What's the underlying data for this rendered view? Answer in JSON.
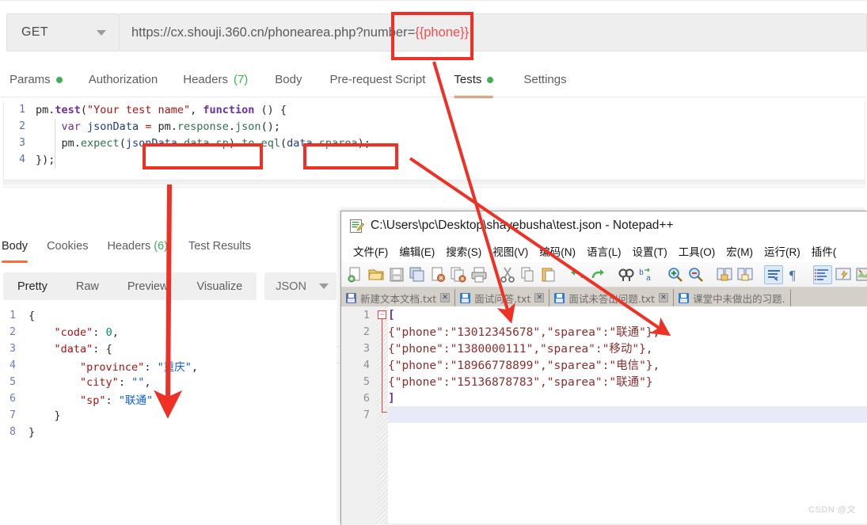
{
  "postman": {
    "request": {
      "method": "GET",
      "url_static": "https://cx.shouji.360.cn/phonearea.php?number=",
      "url_variable": "{{phone}}"
    },
    "request_tabs": [
      {
        "label": "Params",
        "badge": "dot",
        "active": false
      },
      {
        "label": "Authorization",
        "badge": "",
        "active": false
      },
      {
        "label": "Headers",
        "badge": "(7)",
        "active": false
      },
      {
        "label": "Body",
        "badge": "",
        "active": false
      },
      {
        "label": "Pre-request Script",
        "badge": "",
        "active": false
      },
      {
        "label": "Tests",
        "badge": "dot",
        "active": true
      },
      {
        "label": "Settings",
        "badge": "",
        "active": false
      }
    ],
    "tests_code": {
      "lines": [
        {
          "n": "1",
          "text": "pm.test(\"Your test name\", function () {"
        },
        {
          "n": "2",
          "text": "    var jsonData = pm.response.json();"
        },
        {
          "n": "3",
          "text": "    pm.expect(jsonData.data.sp).to.eql(data.sparea);"
        },
        {
          "n": "4",
          "text": "});"
        }
      ]
    },
    "response_tabs": [
      {
        "label": "Body",
        "badge": "",
        "active": true
      },
      {
        "label": "Cookies",
        "badge": "",
        "active": false
      },
      {
        "label": "Headers",
        "badge": "(6)",
        "active": false
      },
      {
        "label": "Test Results",
        "badge": "",
        "active": false
      }
    ],
    "format_tabs": [
      {
        "label": "Pretty",
        "active": true
      },
      {
        "label": "Raw",
        "active": false
      },
      {
        "label": "Preview",
        "active": false
      },
      {
        "label": "Visualize",
        "active": false
      }
    ],
    "format_select": "JSON",
    "response_body": {
      "lines": [
        {
          "n": "1",
          "text": "{"
        },
        {
          "n": "2",
          "key": "\"code\"",
          "sep": ": ",
          "num": "0",
          "tail": ","
        },
        {
          "n": "3",
          "key": "\"data\"",
          "sep": ": ",
          "tail": "{"
        },
        {
          "n": "4",
          "key": "\"province\"",
          "sep": ": ",
          "str": "\"重庆\"",
          "tail": ","
        },
        {
          "n": "5",
          "key": "\"city\"",
          "sep": ": ",
          "str": "\"\"",
          "tail": ","
        },
        {
          "n": "6",
          "key": "\"sp\"",
          "sep": ": ",
          "str": "\"联通\"",
          "tail": ""
        },
        {
          "n": "7",
          "text": "}"
        },
        {
          "n": "8",
          "text": "}"
        }
      ]
    }
  },
  "notepad": {
    "title": "C:\\Users\\pc\\Desktop\\shayebusha\\test.json - Notepad++",
    "menu": [
      "文件(F)",
      "编辑(E)",
      "搜索(S)",
      "视图(V)",
      "编码(N)",
      "语言(L)",
      "设置(T)",
      "工具(O)",
      "宏(M)",
      "运行(R)",
      "插件("
    ],
    "doc_tabs": [
      {
        "label": "新建文本文档.txt",
        "active": false
      },
      {
        "label": "面试问答.txt",
        "active": false
      },
      {
        "label": "面试未答出问题.txt",
        "active": false
      },
      {
        "label": "课堂中未做出的习题.",
        "active": false
      }
    ],
    "editor_lines": [
      {
        "n": "1",
        "text": "["
      },
      {
        "n": "2",
        "text": "{\"phone\":\"13012345678\",\"sparea\":\"联通\"},"
      },
      {
        "n": "3",
        "text": "{\"phone\":\"1380000111\",\"sparea\":\"移动\"},"
      },
      {
        "n": "4",
        "text": "{\"phone\":\"18966778899\",\"sparea\":\"电信\"},"
      },
      {
        "n": "5",
        "text": "{\"phone\":\"15136878783\",\"sparea\":\"联通\"}"
      },
      {
        "n": "6",
        "text": "]"
      },
      {
        "n": "7",
        "text": ""
      }
    ]
  },
  "annotations": {
    "color": "#ee3124",
    "boxes": [
      {
        "name": "phone-variable-highlight"
      },
      {
        "name": "jsondata-expression-highlight"
      },
      {
        "name": "data-sparea-highlight"
      }
    ],
    "arrow_count": 3
  },
  "watermark": "CSDN @文"
}
